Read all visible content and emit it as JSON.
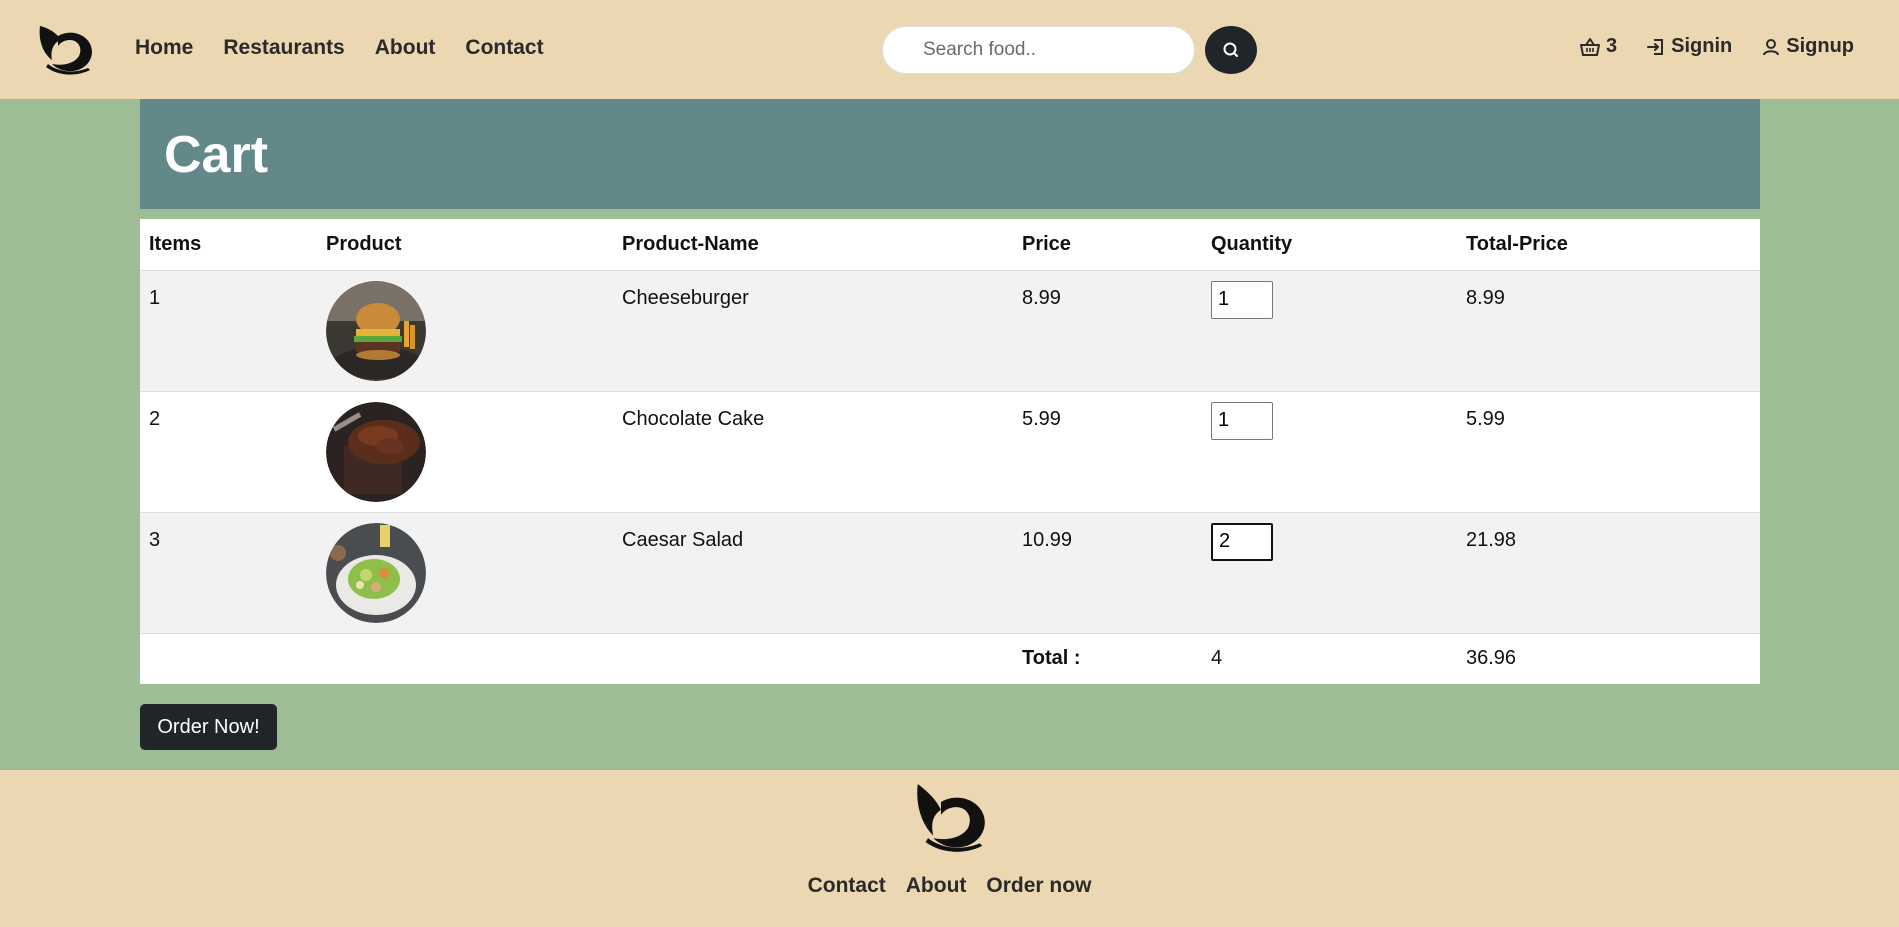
{
  "navbar": {
    "links": [
      "Home",
      "Restaurants",
      "About",
      "Contact"
    ],
    "search_placeholder": "Search food..",
    "cart_count": "3",
    "signin_label": "Signin",
    "signup_label": "Signup"
  },
  "cart": {
    "title": "Cart",
    "columns": [
      "Items",
      "Product",
      "Product-Name",
      "Price",
      "Quantity",
      "Total-Price"
    ],
    "rows": [
      {
        "item": "1",
        "image": "cheeseburger-photo",
        "name": "Cheeseburger",
        "price": "8.99",
        "quantity": "1",
        "total": "8.99"
      },
      {
        "item": "2",
        "image": "chocolate-cake-photo",
        "name": "Chocolate Cake",
        "price": "5.99",
        "quantity": "1",
        "total": "5.99"
      },
      {
        "item": "3",
        "image": "caesar-salad-photo",
        "name": "Caesar Salad",
        "price": "10.99",
        "quantity": "2",
        "total": "21.98"
      }
    ],
    "total_label": "Total :",
    "total_quantity": "4",
    "total_price": "36.96",
    "order_button": "Order Now!"
  },
  "footer": {
    "links": [
      "Contact",
      "About",
      "Order now"
    ]
  },
  "colors": {
    "navbar_bg": "#ebd8b3",
    "page_bg": "#9ebd97",
    "cart_header_bg": "#62888a",
    "button_dark": "#212529"
  },
  "icons": {
    "logo": "swan-logo-icon",
    "search": "search-icon",
    "cart": "basket-icon",
    "signin": "signin-icon",
    "signup": "user-icon"
  }
}
